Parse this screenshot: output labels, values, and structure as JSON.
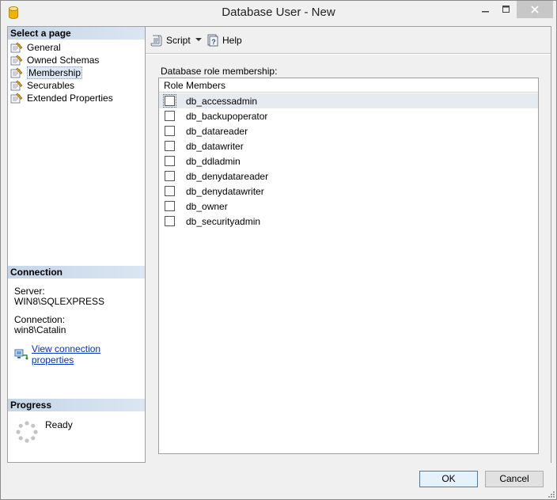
{
  "window": {
    "title": "Database User - New"
  },
  "left_panel": {
    "select_page_header": "Select a page",
    "pages": [
      {
        "label": "General",
        "icon": "page-wrench-icon"
      },
      {
        "label": "Owned Schemas",
        "icon": "page-wrench-icon"
      },
      {
        "label": "Membership",
        "icon": "page-wrench-icon",
        "selected": true
      },
      {
        "label": "Securables",
        "icon": "page-wrench-icon"
      },
      {
        "label": "Extended Properties",
        "icon": "page-wrench-icon"
      }
    ],
    "connection_header": "Connection",
    "server_label": "Server:",
    "server_value": "WIN8\\SQLEXPRESS",
    "connection_label": "Connection:",
    "connection_value": "win8\\Catalin",
    "view_connection_link": "View connection properties",
    "progress_header": "Progress",
    "progress_status": "Ready"
  },
  "toolbar": {
    "script_label": "Script",
    "help_label": "Help"
  },
  "main": {
    "membership_label": "Database role membership:",
    "grid_header": "Role Members",
    "roles": [
      {
        "name": "db_accessadmin",
        "checked": false
      },
      {
        "name": "db_backupoperator",
        "checked": false
      },
      {
        "name": "db_datareader",
        "checked": false
      },
      {
        "name": "db_datawriter",
        "checked": false
      },
      {
        "name": "db_ddladmin",
        "checked": false
      },
      {
        "name": "db_denydatareader",
        "checked": false
      },
      {
        "name": "db_denydatawriter",
        "checked": false
      },
      {
        "name": "db_owner",
        "checked": false
      },
      {
        "name": "db_securityadmin",
        "checked": false
      }
    ]
  },
  "buttons": {
    "ok_label": "OK",
    "cancel_label": "Cancel"
  }
}
